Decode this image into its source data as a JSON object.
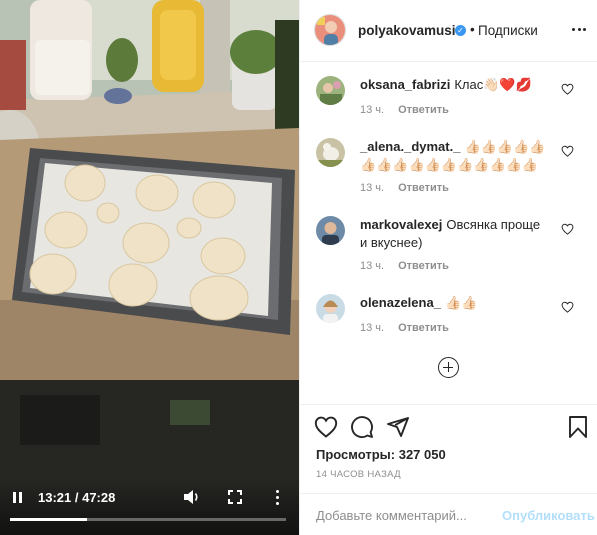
{
  "video": {
    "time_label": "13:21 / 47:28",
    "progress_fraction": 0.28
  },
  "post": {
    "username": "polyakovamusic",
    "dot": "•",
    "follow_label": "Подписки",
    "views_label": "Просмотры:",
    "views_count": "327 050",
    "time_ago": "14 ЧАСОВ НАЗАД"
  },
  "comments": [
    {
      "username": "oksana_fabrizi",
      "text": "Клас👋🏻❤️💋",
      "time": "13 ч.",
      "reply_label": "Ответить"
    },
    {
      "username": "_alena._dymat._",
      "text": "👍🏻👍🏻👍🏻👍🏻👍🏻👍🏻👍🏻👍🏻👍🏻👍🏻👍🏻👍🏻👍🏻👍🏻👍🏻👍🏻",
      "time": "13 ч.",
      "reply_label": "Ответить"
    },
    {
      "username": "markovalexej",
      "text": "Овсянка проще и вкуснее)",
      "time": "13 ч.",
      "reply_label": "Ответить"
    },
    {
      "username": "olenazelena_",
      "text": "👍🏻👍🏻",
      "time": "13 ч.",
      "reply_label": "Ответить"
    }
  ],
  "add_comment": {
    "placeholder": "Добавьте комментарий...",
    "post_label": "Опубликовать"
  },
  "icons": {
    "verified": "verified-badge-icon",
    "like": "heart-icon",
    "comment": "comment-bubble-icon",
    "share": "paper-plane-icon",
    "save": "bookmark-icon",
    "load_more": "plus-circle-icon"
  },
  "colors": {
    "verified": "#3897f0",
    "post_button_disabled": "#b2dffc",
    "meta_text": "#8e8e8e"
  }
}
